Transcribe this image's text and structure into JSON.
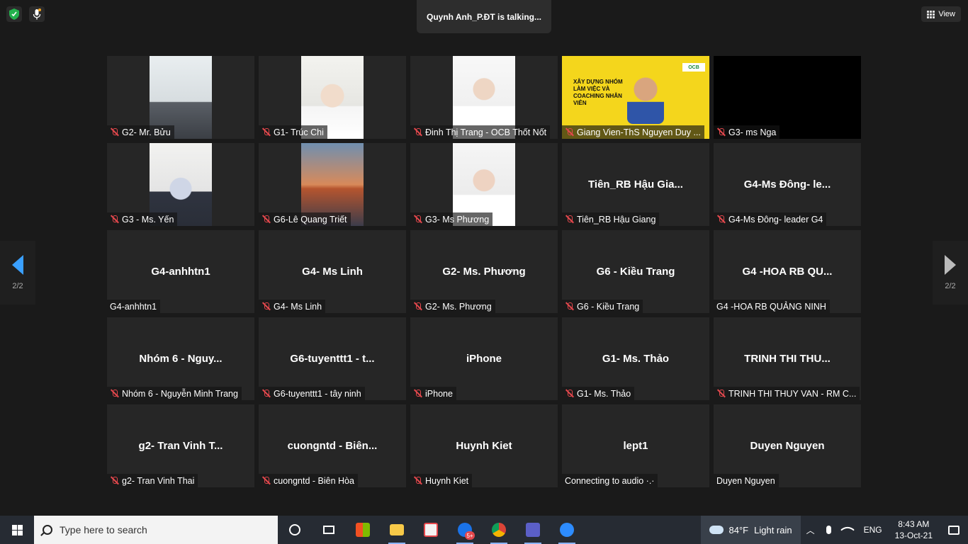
{
  "topbar": {
    "talking": "Quynh Anh_P.ĐT is talking...",
    "view_label": "View"
  },
  "nav": {
    "left_page": "2/2",
    "right_page": "2/2"
  },
  "presenter_slide": {
    "title": "XÂY DỰNG NHÓM LÀM VIỆC VÀ COACHING NHÂN VIÊN",
    "logo": "OCB"
  },
  "tiles": [
    {
      "big": "",
      "name": "G2- Mr. Bửu",
      "muted": true,
      "video": "vid-office"
    },
    {
      "big": "",
      "name": "G1- Trúc Chi",
      "muted": true,
      "video": "vid-person1"
    },
    {
      "big": "",
      "name": "Đinh Thị Trang - OCB Thốt Nốt",
      "muted": true,
      "video": "vid-person2"
    },
    {
      "big": "",
      "name": "Giang Vien-ThS Nguyen Duy ...",
      "muted": true,
      "video": "presenter"
    },
    {
      "big": "",
      "name": "G3- ms Nga",
      "muted": true,
      "video": "black"
    },
    {
      "big": "",
      "name": "G3 - Ms. Yến",
      "muted": true,
      "video": "vid-person3"
    },
    {
      "big": "",
      "name": "G6-Lê Quang Triết",
      "muted": true,
      "video": "vid-bridge"
    },
    {
      "big": "",
      "name": "G3- Ms Phương",
      "muted": true,
      "video": "vid-person4"
    },
    {
      "big": "Tiên_RB Hậu Gia...",
      "name": "Tiên_RB Hậu Giang",
      "muted": true,
      "video": ""
    },
    {
      "big": "G4-Ms Đông- le...",
      "name": "G4-Ms Đông- leader G4",
      "muted": true,
      "video": ""
    },
    {
      "big": "G4-anhhtn1",
      "name": "G4-anhhtn1",
      "muted": false,
      "video": ""
    },
    {
      "big": "G4- Ms Linh",
      "name": "G4- Ms Linh",
      "muted": true,
      "video": ""
    },
    {
      "big": "G2- Ms. Phương",
      "name": "G2- Ms. Phương",
      "muted": true,
      "video": ""
    },
    {
      "big": "G6 - Kiều Trang",
      "name": "G6 - Kiều Trang",
      "muted": true,
      "video": ""
    },
    {
      "big": "G4 -HOA RB QU...",
      "name": "G4 -HOA RB QUẢNG NINH",
      "muted": false,
      "video": ""
    },
    {
      "big": "Nhóm 6 - Nguy...",
      "name": "Nhóm 6 - Nguyễn Minh Trang",
      "muted": true,
      "video": ""
    },
    {
      "big": "G6-tuyenttt1 - t...",
      "name": "G6-tuyenttt1 - tây ninh",
      "muted": true,
      "video": ""
    },
    {
      "big": "iPhone",
      "name": "iPhone",
      "muted": true,
      "video": ""
    },
    {
      "big": "G1- Ms. Thảo",
      "name": "G1- Ms. Thảo",
      "muted": true,
      "video": ""
    },
    {
      "big": "TRINH THI THU...",
      "name": "TRINH THI THUY VAN - RM C...",
      "muted": true,
      "video": ""
    },
    {
      "big": "g2- Tran Vinh T...",
      "name": "g2- Tran Vinh Thai",
      "muted": true,
      "video": ""
    },
    {
      "big": "cuongntd - Biên...",
      "name": "cuongntd - Biên Hòa",
      "muted": true,
      "video": ""
    },
    {
      "big": "Huynh Kiet",
      "name": "Huynh Kiet",
      "muted": true,
      "video": ""
    },
    {
      "big": "lept1",
      "name": "Connecting to audio ·.·",
      "muted": false,
      "video": ""
    },
    {
      "big": "Duyen Nguyen",
      "name": "Duyen Nguyen",
      "muted": false,
      "video": ""
    }
  ],
  "taskbar": {
    "search_placeholder": "Type here to search",
    "badge_messenger": "5+",
    "badge_top": "1",
    "weather_temp": "84°F",
    "weather_text": "Light rain",
    "language": "ENG",
    "time": "8:43 AM",
    "date": "13-Oct-21"
  },
  "colors": {
    "accent": "#3aa0ff",
    "mute": "#e5484d",
    "presenter_bg": "#f4d61c"
  }
}
